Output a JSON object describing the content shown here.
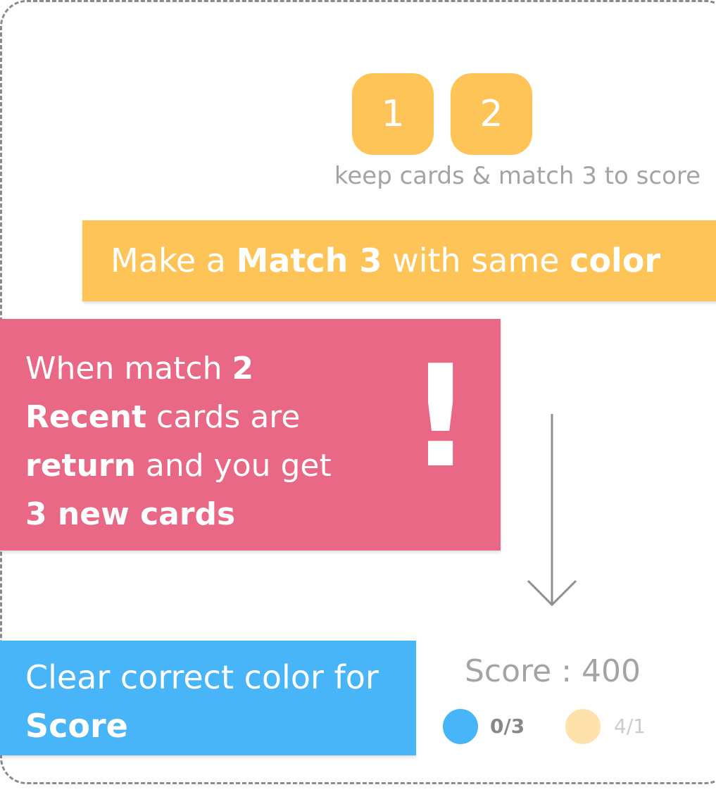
{
  "cards": [
    {
      "label": "1"
    },
    {
      "label": "2"
    }
  ],
  "hint": "keep cards & match 3 to score",
  "yellow_banner": {
    "part1": "Make a ",
    "bold1": "Match 3",
    "part2": " with same ",
    "bold2": "color"
  },
  "red_banner": {
    "t1": "When match ",
    "b1": "2",
    "b2": "Recent",
    "t2": " cards are ",
    "b3": "return",
    "t3": " and you get ",
    "b4": "3 new cards",
    "exclaim": "!"
  },
  "blue_banner": {
    "t1": "Clear correct color for ",
    "b1": "Score"
  },
  "score": {
    "label": "Score : 400",
    "blue_count": "0/3",
    "yellow_count": "4/1"
  },
  "colors": {
    "yellow": "#ffc457",
    "red": "#e86885",
    "blue": "#47b5f7",
    "grey_text": "#a4a4a4"
  },
  "icons": {
    "arrow": "arrow-down-icon"
  }
}
